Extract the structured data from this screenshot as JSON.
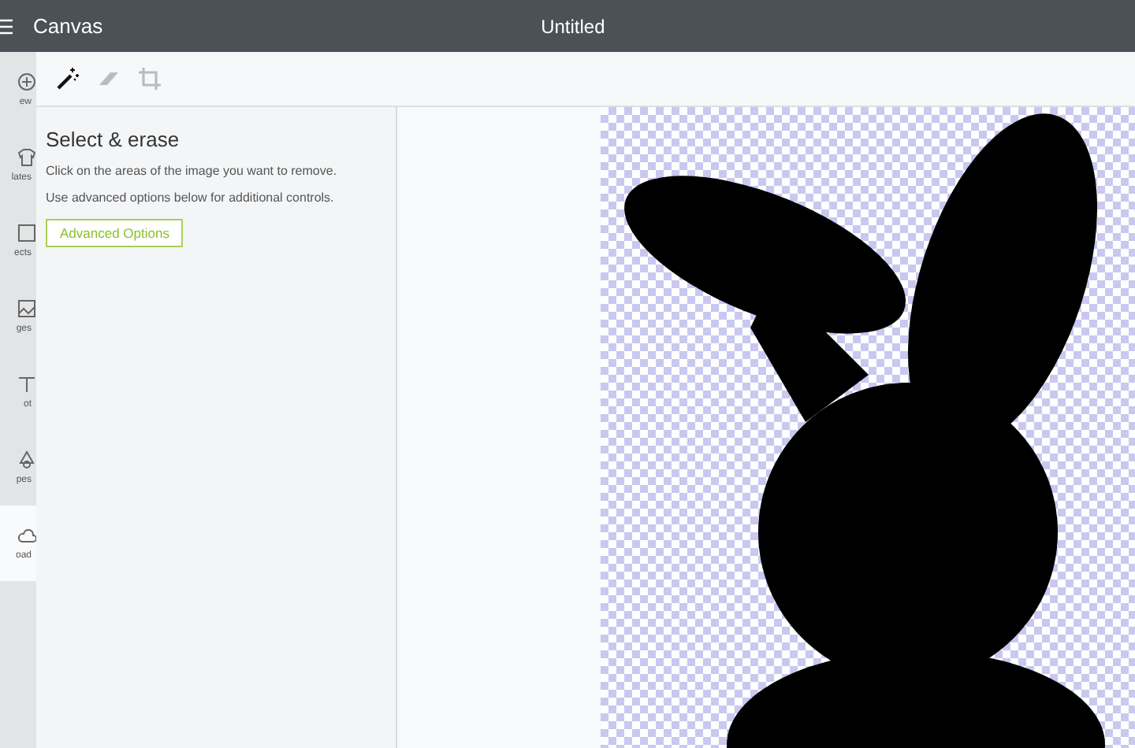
{
  "top_bar": {
    "app_name": "Canvas",
    "document_title": "Untitled"
  },
  "sidebar": {
    "items": [
      {
        "label": "ew",
        "selected": false,
        "kind": "plus"
      },
      {
        "label": "lates",
        "selected": false,
        "kind": "shirt"
      },
      {
        "label": "ects",
        "selected": false,
        "kind": "square"
      },
      {
        "label": "ges",
        "selected": false,
        "kind": "image"
      },
      {
        "label": "ot",
        "selected": false,
        "kind": "text"
      },
      {
        "label": "pes",
        "selected": false,
        "kind": "shapes"
      },
      {
        "label": "oad",
        "selected": true,
        "kind": "upload"
      }
    ]
  },
  "tools": [
    {
      "kind": "wand",
      "selected": true
    },
    {
      "kind": "eraser",
      "selected": false
    },
    {
      "kind": "crop",
      "selected": false
    }
  ],
  "panel": {
    "title": "Select & erase",
    "lines": [
      "Click on the areas of the image you want to remove.",
      "Use advanced options below for additional controls."
    ],
    "button": "Advanced Options"
  }
}
